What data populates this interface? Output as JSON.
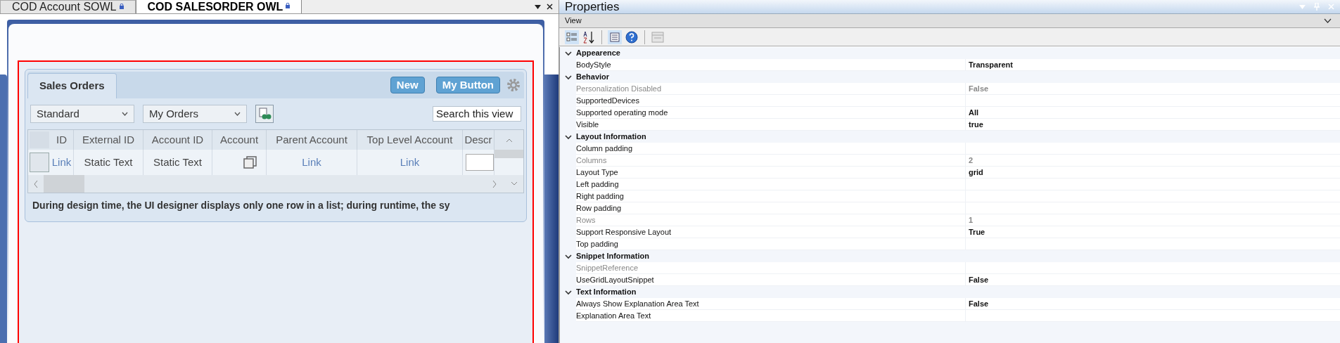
{
  "document_tabs": [
    {
      "label": "COD Account SOWL",
      "selected": false
    },
    {
      "label": "COD SALESORDER OWL",
      "selected": true
    }
  ],
  "designer": {
    "panel_tab": "Sales Orders",
    "buttons": [
      "New",
      "My Button"
    ],
    "dropdowns": [
      "Standard",
      "My Orders"
    ],
    "search": {
      "placeholder": "Search this view"
    },
    "table": {
      "columns": [
        "ID",
        "External ID",
        "Account ID",
        "Account",
        "Parent Account",
        "Top Level Account",
        "Descr"
      ],
      "row": [
        {
          "kind": "link",
          "text": "Link"
        },
        {
          "kind": "text",
          "text": "Static Text"
        },
        {
          "kind": "text",
          "text": "Static Text"
        },
        {
          "kind": "icon"
        },
        {
          "kind": "link",
          "text": "Link"
        },
        {
          "kind": "link",
          "text": "Link"
        },
        {
          "kind": "input"
        }
      ]
    },
    "explanation": "During design time, the UI designer displays only one row in a list; during runtime, the sy"
  },
  "properties": {
    "title": "Properties",
    "view": "View",
    "categories": [
      {
        "name": "Appearence",
        "expanded": true,
        "items": [
          {
            "name": "BodyStyle",
            "value": "Transparent",
            "disabled": false
          }
        ]
      },
      {
        "name": "Behavior",
        "expanded": true,
        "items": [
          {
            "name": "Personalization Disabled",
            "value": "False",
            "disabled": true
          },
          {
            "name": "SupportedDevices",
            "disabled": false
          },
          {
            "name": "Supported operating mode",
            "value": "All",
            "disabled": false
          },
          {
            "name": "Visible",
            "value": "true",
            "disabled": false
          }
        ]
      },
      {
        "name": "Layout Information",
        "expanded": true,
        "items": [
          {
            "name": "Column padding",
            "disabled": false
          },
          {
            "name": "Columns",
            "value": "2",
            "disabled": true
          },
          {
            "name": "Layout Type",
            "value": "grid",
            "disabled": false
          },
          {
            "name": "Left padding",
            "disabled": false
          },
          {
            "name": "Right padding",
            "disabled": false
          },
          {
            "name": "Row padding",
            "disabled": false
          },
          {
            "name": "Rows",
            "value": "1",
            "disabled": true
          },
          {
            "name": "Support Responsive Layout",
            "value": "True",
            "disabled": false
          },
          {
            "name": "Top padding",
            "disabled": false
          }
        ]
      },
      {
        "name": "Snippet Information",
        "expanded": true,
        "items": [
          {
            "name": "SnippetReference",
            "disabled": true
          },
          {
            "name": "UseGridLayoutSnippet",
            "value": "False",
            "disabled": false
          }
        ]
      },
      {
        "name": "Text Information",
        "expanded": true,
        "items": [
          {
            "name": "Always Show Explanation Area Text",
            "value": "False",
            "disabled": false
          },
          {
            "name": "Explanation Area Text",
            "disabled": false
          }
        ]
      }
    ]
  }
}
